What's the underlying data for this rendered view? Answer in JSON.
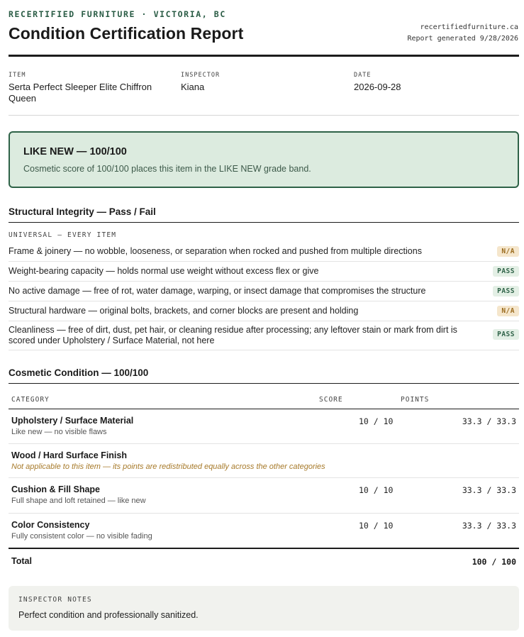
{
  "header": {
    "brand": "RECERTIFIED FURNITURE · VICTORIA, BC",
    "title": "Condition Certification Report",
    "site": "recertifiedfurniture.ca",
    "generated": "Report generated 9/28/2026"
  },
  "meta": {
    "item_label": "ITEM",
    "item_value": "Serta Perfect Sleeper Elite Chiffron Queen",
    "inspector_label": "INSPECTOR",
    "inspector_value": "Kiana",
    "date_label": "DATE",
    "date_value": "2026-09-28"
  },
  "grade": {
    "title": "LIKE NEW — 100/100",
    "description": "Cosmetic score of 100/100 places this item in the LIKE NEW grade band."
  },
  "structural": {
    "title": "Structural Integrity — Pass / Fail",
    "subhead": "UNIVERSAL — EVERY ITEM",
    "checks": [
      {
        "text": "Frame & joinery — no wobble, looseness, or separation when rocked and pushed from multiple directions",
        "status": "N/A"
      },
      {
        "text": "Weight-bearing capacity — holds normal use weight without excess flex or give",
        "status": "PASS"
      },
      {
        "text": "No active damage — free of rot, water damage, warping, or insect damage that compromises the structure",
        "status": "PASS"
      },
      {
        "text": "Structural hardware — original bolts, brackets, and corner blocks are present and holding",
        "status": "N/A"
      },
      {
        "text": "Cleanliness — free of dirt, dust, pet hair, or cleaning residue after processing; any leftover stain or mark from dirt is scored under Upholstery / Surface Material, not here",
        "status": "PASS"
      }
    ]
  },
  "cosmetic": {
    "title": "Cosmetic Condition — 100/100",
    "col_category": "CATEGORY",
    "col_score": "SCORE",
    "col_points": "POINTS",
    "rows": [
      {
        "name": "Upholstery / Surface Material",
        "sub": "Like new — no visible flaws",
        "score": "10 / 10",
        "points": "33.3 / 33.3"
      },
      {
        "name": "Wood / Hard Surface Finish",
        "sub": "Not applicable to this item — its points are redistributed equally across the other categories",
        "score": "",
        "points": ""
      },
      {
        "name": "Cushion & Fill Shape",
        "sub": "Full shape and loft retained — like new",
        "score": "10 / 10",
        "points": "33.3 / 33.3"
      },
      {
        "name": "Color Consistency",
        "sub": "Fully consistent color — no visible fading",
        "score": "10 / 10",
        "points": "33.3 / 33.3"
      }
    ],
    "total_label": "Total",
    "total_value": "100 / 100"
  },
  "notes": {
    "label": "INSPECTOR NOTES",
    "text": "Perfect condition and professionally sanitized."
  }
}
